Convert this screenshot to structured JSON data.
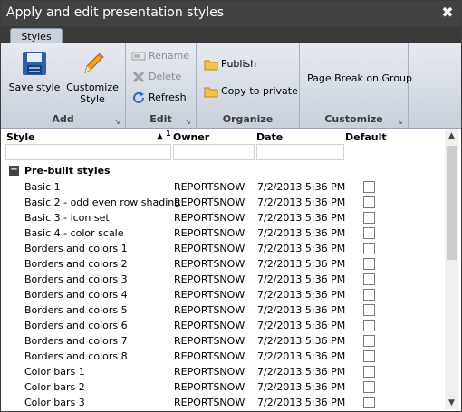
{
  "window": {
    "title": "Apply and edit presentation styles",
    "close_glyph": "✖"
  },
  "tabs": [
    {
      "label": "Styles"
    }
  ],
  "ribbon": {
    "add": {
      "label": "Add",
      "save_style": "Save style",
      "customize_style_line1": "Customize",
      "customize_style_line2": "Style"
    },
    "edit": {
      "label": "Edit",
      "rename": "Rename",
      "delete": "Delete",
      "refresh": "Refresh"
    },
    "organize": {
      "label": "Organize",
      "publish": "Publish",
      "copy_to_private": "Copy to private"
    },
    "customize": {
      "label": "Customize",
      "page_break_on_group": "Page Break on Group"
    },
    "launcher_glyph": "↘"
  },
  "grid": {
    "columns": {
      "style": "Style",
      "owner": "Owner",
      "date": "Date",
      "default": "Default"
    },
    "sort_indicator": "▲",
    "sort_order": "1",
    "group": {
      "collapse_glyph": "−",
      "title": "Pre-built styles"
    },
    "rows": [
      {
        "style": "Basic 1",
        "owner": "REPORTSNOW",
        "date": "7/2/2013 5:36 PM",
        "default": false
      },
      {
        "style": "Basic 2 - odd even row shading",
        "owner": "REPORTSNOW",
        "date": "7/2/2013 5:36 PM",
        "default": false
      },
      {
        "style": "Basic 3 - icon set",
        "owner": "REPORTSNOW",
        "date": "7/2/2013 5:36 PM",
        "default": false
      },
      {
        "style": "Basic 4 - color scale",
        "owner": "REPORTSNOW",
        "date": "7/2/2013 5:36 PM",
        "default": false
      },
      {
        "style": "Borders and colors 1",
        "owner": "REPORTSNOW",
        "date": "7/2/2013 5:36 PM",
        "default": false
      },
      {
        "style": "Borders and colors 2",
        "owner": "REPORTSNOW",
        "date": "7/2/2013 5:36 PM",
        "default": false
      },
      {
        "style": "Borders and colors 3",
        "owner": "REPORTSNOW",
        "date": "7/2/2013 5:36 PM",
        "default": false
      },
      {
        "style": "Borders and colors 4",
        "owner": "REPORTSNOW",
        "date": "7/2/2013 5:36 PM",
        "default": false
      },
      {
        "style": "Borders and colors 5",
        "owner": "REPORTSNOW",
        "date": "7/2/2013 5:36 PM",
        "default": false
      },
      {
        "style": "Borders and colors 6",
        "owner": "REPORTSNOW",
        "date": "7/2/2013 5:36 PM",
        "default": false
      },
      {
        "style": "Borders and colors 7",
        "owner": "REPORTSNOW",
        "date": "7/2/2013 5:36 PM",
        "default": false
      },
      {
        "style": "Borders and colors 8",
        "owner": "REPORTSNOW",
        "date": "7/2/2013 5:36 PM",
        "default": false
      },
      {
        "style": "Color bars 1",
        "owner": "REPORTSNOW",
        "date": "7/2/2013 5:36 PM",
        "default": false
      },
      {
        "style": "Color bars 2",
        "owner": "REPORTSNOW",
        "date": "7/2/2013 5:36 PM",
        "default": false
      },
      {
        "style": "Color bars 3",
        "owner": "REPORTSNOW",
        "date": "7/2/2013 5:36 PM",
        "default": false
      }
    ]
  },
  "scrollbar": {
    "up_glyph": "▲",
    "down_glyph": "▼"
  },
  "icons": {
    "save_style": "floppy-disk-icon",
    "customize_style": "pencil-icon",
    "rename": "rename-icon",
    "delete": "delete-x-icon",
    "refresh": "refresh-icon",
    "publish": "folder-icon",
    "copy_to_private": "folder-icon"
  },
  "colors": {
    "titlebar": "#424242",
    "ribbon_top": "#e6eaf0",
    "ribbon_bottom": "#c9d0db",
    "tab": "#c9d0db"
  }
}
